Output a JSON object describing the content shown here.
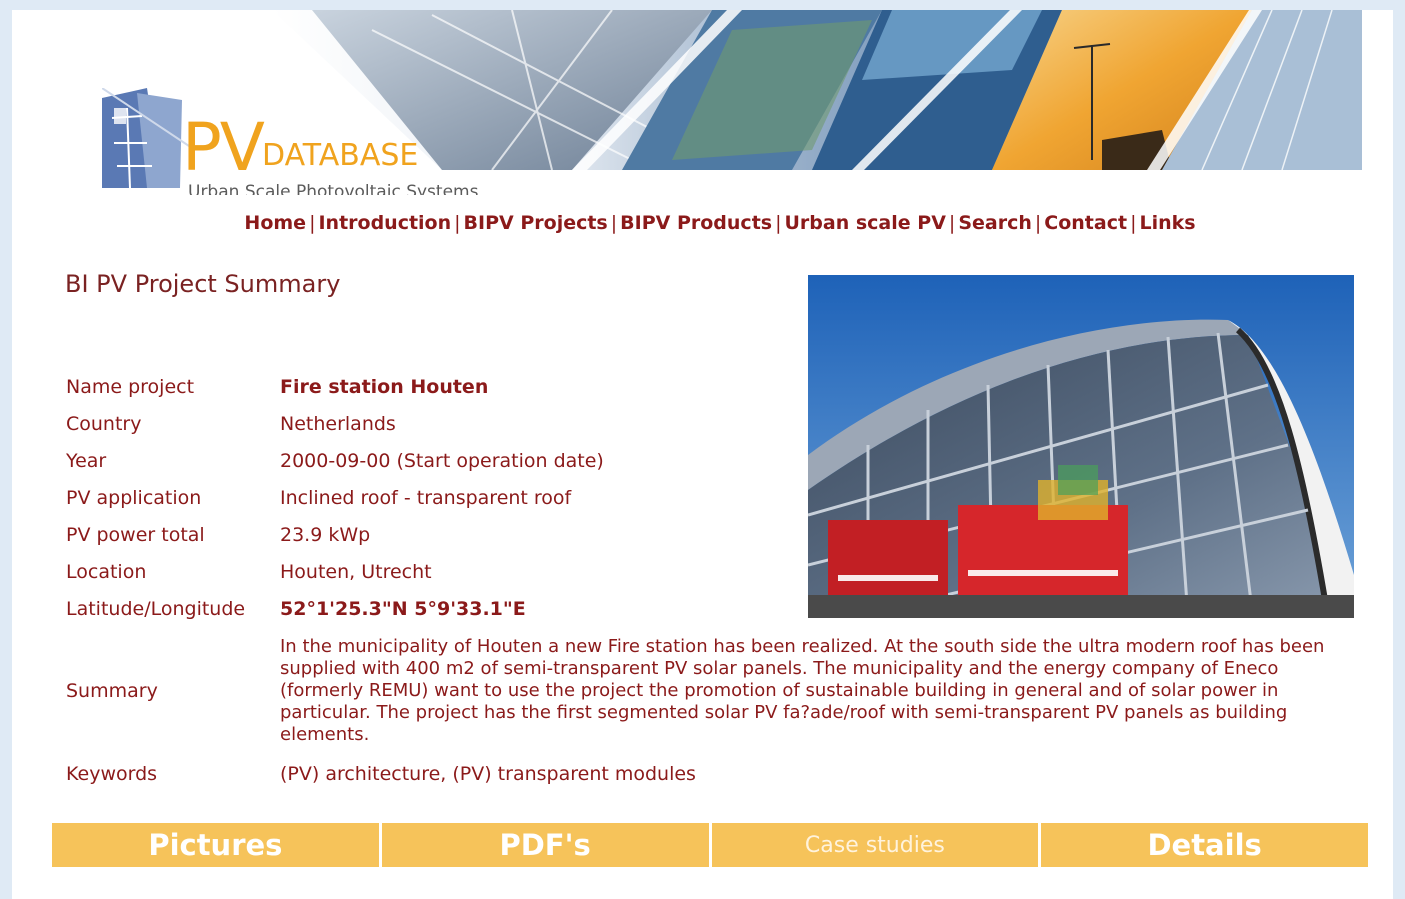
{
  "header": {
    "logo_pv": "PV",
    "logo_database": "DATABASE",
    "logo_subtitle": "Urban Scale Photovoltaic Systems"
  },
  "nav": {
    "items": [
      {
        "label": "Home"
      },
      {
        "label": "Introduction"
      },
      {
        "label": "BIPV Projects"
      },
      {
        "label": "BIPV Products"
      },
      {
        "label": "Urban scale PV"
      },
      {
        "label": "Search"
      },
      {
        "label": "Contact"
      },
      {
        "label": "Links"
      }
    ],
    "separator": "|"
  },
  "summary": {
    "heading": "BI PV Project Summary",
    "rows": {
      "name": {
        "label": "Name project",
        "value": "Fire station Houten"
      },
      "country": {
        "label": "Country",
        "value": "Netherlands"
      },
      "year": {
        "label": "Year",
        "value": "2000-09-00 (Start operation date)"
      },
      "application": {
        "label": "PV application",
        "value": "Inclined roof - transparent roof"
      },
      "power": {
        "label": "PV power total",
        "value": "23.9 kWp"
      },
      "location": {
        "label": "Location",
        "value": "Houten, Utrecht"
      },
      "latlon": {
        "label": "Latitude/Longitude",
        "value": "52°1'25.3\"N 5°9'33.1\"E"
      },
      "summary": {
        "label": "Summary",
        "value": "In the municipality of Houten a new Fire station has been realized. At the south side the ultra modern roof has been supplied with 400 m2 of semi-transparent PV solar panels. The municipality and the energy company of Eneco (formerly REMU) want to use the project the promotion of sustainable building in general and of solar power in particular. The project has the first segmented solar PV fa?ade/roof with semi-transparent PV panels as building elements."
      },
      "keywords": {
        "label": "Keywords",
        "value": "(PV) architecture, (PV) transparent modules"
      }
    }
  },
  "buttons": {
    "pictures": "Pictures",
    "pdfs": "PDF's",
    "case_studies": "Case studies",
    "details": "Details"
  },
  "colors": {
    "accent_orange": "#f6c35a",
    "text_maroon": "#8b1a1a",
    "logo_orange": "#f0a31e",
    "page_bg": "#dfeaf5"
  }
}
